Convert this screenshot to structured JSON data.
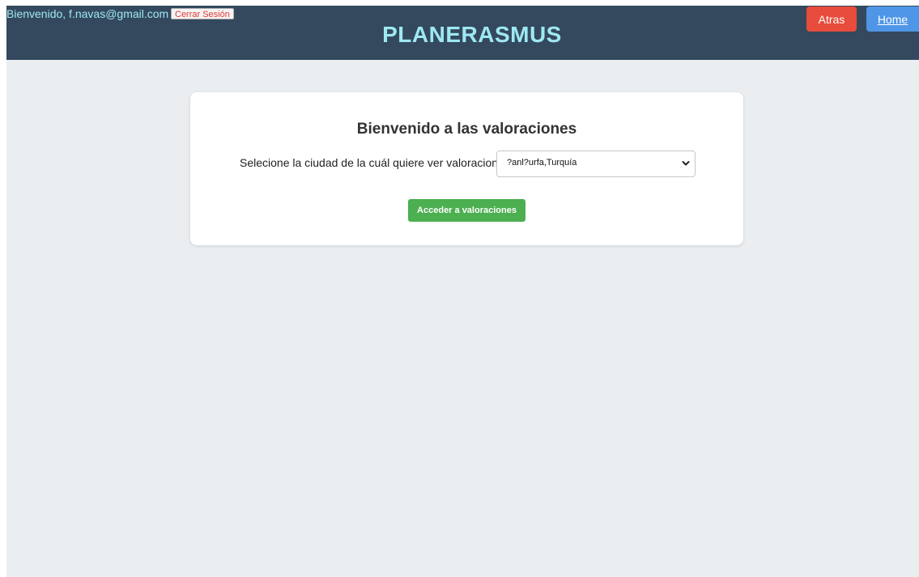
{
  "header": {
    "welcome_text": "Bienvenido, f.navas@gmail.com",
    "logout_label": "Cerrar Sesión",
    "brand": "PLANERASMUS",
    "back_label": "Atras",
    "home_label": "Home"
  },
  "main": {
    "title": "Bienvenido a las valoraciones",
    "select_label": "Selecione la ciudad de la cuál quiere ver valoraciones:",
    "selected_city": "?anl?urfa,Turquía",
    "submit_label": "Acceder a valoraciones"
  },
  "colors": {
    "header_bg": "#34495e",
    "brand_text": "#9ee8f2",
    "back_button": "#e74c3c",
    "home_button": "#4f97e6",
    "submit_button": "#4caf50",
    "page_bg": "#ebeef0"
  },
  "icons": {
    "select_arrow": "chevron-down-icon"
  }
}
